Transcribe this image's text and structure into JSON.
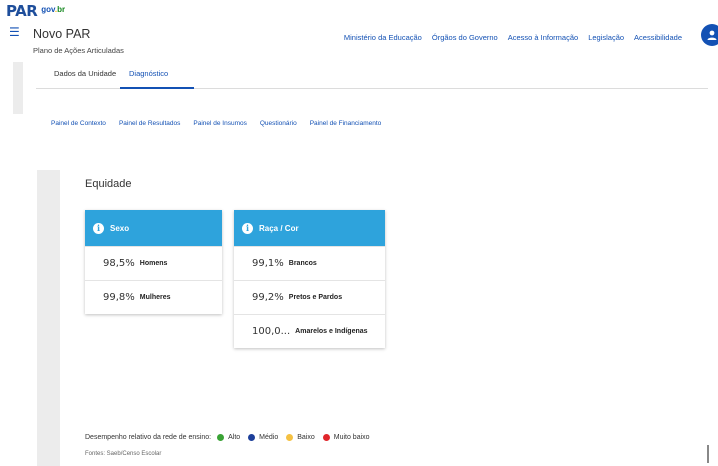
{
  "header": {
    "logo_text": "PAR",
    "govbr_parts": [
      "gov",
      ".",
      "br"
    ],
    "app_title": "Novo PAR",
    "app_subtitle": "Plano de Ações Articuladas",
    "nav_links": [
      "Ministério da Educação",
      "Órgãos do Governo",
      "Acesso à Informação",
      "Legislação",
      "Acessibilidade"
    ],
    "menu_icon": "hamburger-icon",
    "avatar_icon": "user-icon"
  },
  "tabs": [
    {
      "label": "Dados da Unidade",
      "active": false
    },
    {
      "label": "Diagnóstico",
      "active": true
    }
  ],
  "subtabs": [
    "Painel de Contexto",
    "Painel de Resultados",
    "Painel de Insumos",
    "Questionário",
    "Painel de Financiamento"
  ],
  "section": {
    "title": "Equidade"
  },
  "cards": {
    "sexo": {
      "title": "Sexo",
      "rows": [
        {
          "value": "98,5%",
          "label": "Homens"
        },
        {
          "value": "99,8%",
          "label": "Mulheres"
        }
      ]
    },
    "raca": {
      "title": "Raça / Cor",
      "rows": [
        {
          "value": "99,1%",
          "label": "Brancos"
        },
        {
          "value": "99,2%",
          "label": "Pretos e Pardos"
        },
        {
          "value": "100,0...",
          "label": "Amarelos e Indígenas"
        }
      ]
    }
  },
  "legend": {
    "title": "Desempenho relativo da rede de ensino:",
    "items": [
      {
        "label": "Alto",
        "color": "#3aa335"
      },
      {
        "label": "Médio",
        "color": "#1d3f9a"
      },
      {
        "label": "Baixo",
        "color": "#f5c142"
      },
      {
        "label": "Muito baixo",
        "color": "#e0262b"
      }
    ],
    "source": "Fontes: Saeb/Censo Escolar"
  },
  "colors": {
    "primary": "#1351b4",
    "card_header": "#2ea3dc"
  }
}
